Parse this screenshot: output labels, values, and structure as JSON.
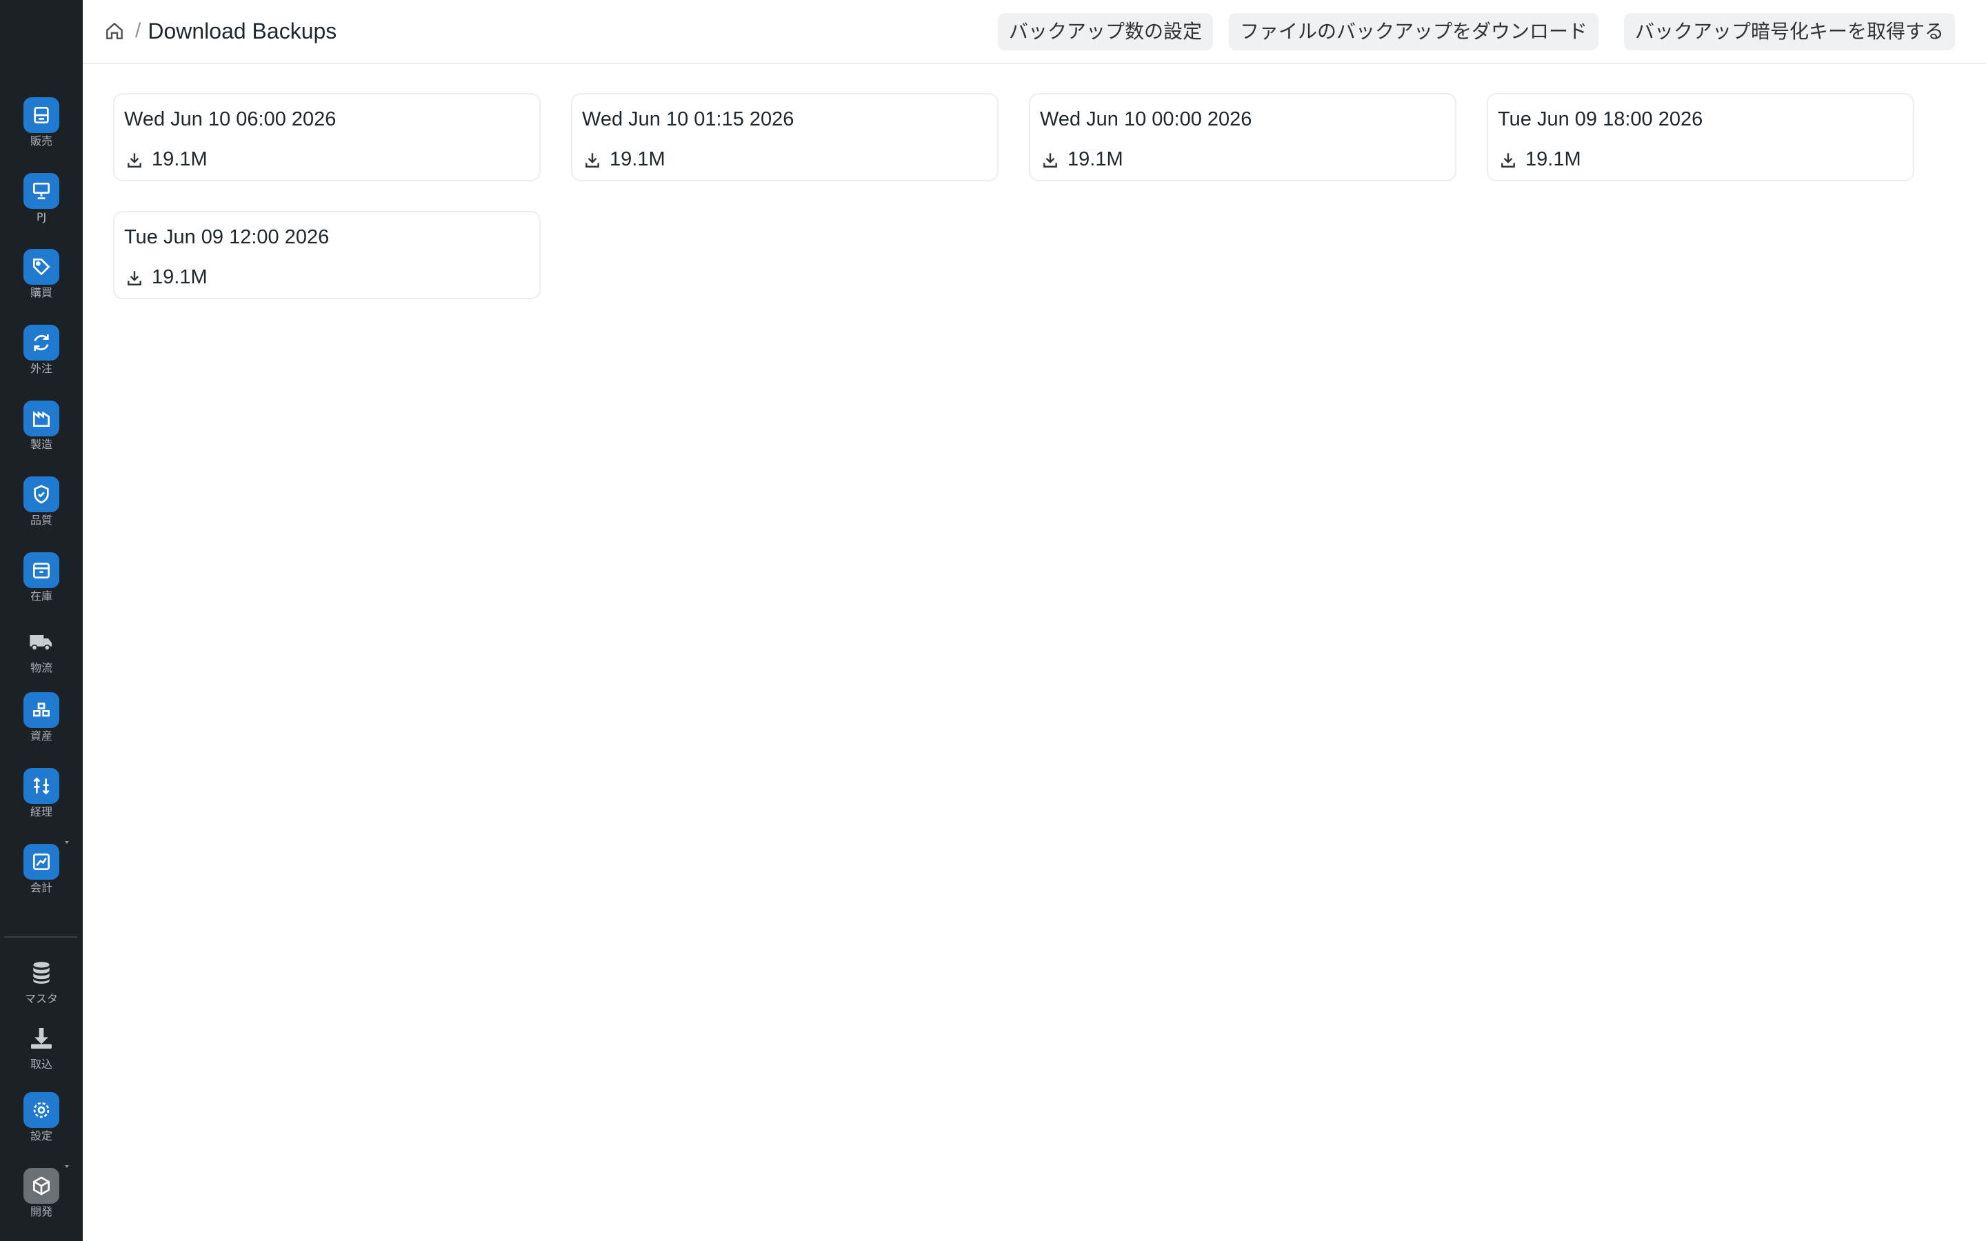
{
  "sidebar": {
    "items": [
      {
        "label": "販売",
        "icon": "receipt-icon"
      },
      {
        "label": "PJ",
        "icon": "presentation-icon"
      },
      {
        "label": "購買",
        "icon": "tag-icon"
      },
      {
        "label": "外注",
        "icon": "refresh-icon"
      },
      {
        "label": "製造",
        "icon": "factory-icon"
      },
      {
        "label": "品質",
        "icon": "shield-check-icon"
      },
      {
        "label": "在庫",
        "icon": "box-icon"
      },
      {
        "label": "物流",
        "icon": "truck-icon"
      },
      {
        "label": "資産",
        "icon": "boxes-icon"
      },
      {
        "label": "経理",
        "icon": "arrows-icon"
      },
      {
        "label": "会計",
        "icon": "chart-line-icon"
      },
      {
        "label": "マスタ",
        "icon": "database-icon"
      },
      {
        "label": "取込",
        "icon": "download-tray-icon"
      },
      {
        "label": "設定",
        "icon": "gear-icon"
      },
      {
        "label": "開発",
        "icon": "cube-icon"
      }
    ],
    "accent": "#1f7ad0",
    "background": "#1c2126"
  },
  "header": {
    "page_title": "Download Backups",
    "breadcrumb_separator": "/",
    "buttons": {
      "set_count": "バックアップ数の設定",
      "download_files": "ファイルのバックアップをダウンロード",
      "get_key": "バックアップ暗号化キーを取得する"
    }
  },
  "backups": [
    {
      "date": "Wed Jun 10 06:00 2026",
      "size": "19.1M"
    },
    {
      "date": "Wed Jun 10 01:15 2026",
      "size": "19.1M"
    },
    {
      "date": "Wed Jun 10 00:00 2026",
      "size": "19.1M"
    },
    {
      "date": "Tue Jun 09 18:00 2026",
      "size": "19.1M"
    },
    {
      "date": "Tue Jun 09 12:00 2026",
      "size": "19.1M"
    }
  ]
}
